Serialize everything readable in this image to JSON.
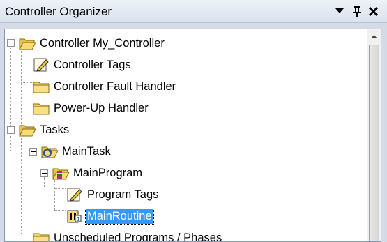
{
  "window": {
    "title": "Controller Organizer",
    "pin_glyph": "p",
    "close_glyph": "✕",
    "menu_glyph": "▾"
  },
  "tree": {
    "items": [
      {
        "label": "Controller My_Controller",
        "icon": "folder-open-icon",
        "expanded": true,
        "selected": false
      },
      {
        "label": "Controller Tags",
        "icon": "tags-icon",
        "selected": false
      },
      {
        "label": "Controller Fault Handler",
        "icon": "folder-icon",
        "selected": false
      },
      {
        "label": "Power-Up Handler",
        "icon": "folder-icon",
        "selected": false
      },
      {
        "label": "Tasks",
        "icon": "folder-open-icon",
        "expanded": true,
        "selected": false
      },
      {
        "label": "MainTask",
        "icon": "task-icon",
        "expanded": true,
        "selected": false
      },
      {
        "label": "MainProgram",
        "icon": "program-icon",
        "expanded": true,
        "selected": false
      },
      {
        "label": "Program Tags",
        "icon": "tags-icon",
        "selected": false
      },
      {
        "label": "MainRoutine",
        "icon": "routine-icon",
        "selected": true
      },
      {
        "label": "Unscheduled Programs / Phases",
        "icon": "folder-icon",
        "selected": false
      }
    ]
  },
  "colors": {
    "selection": "#3399ff",
    "folder": "#f2d25a"
  }
}
